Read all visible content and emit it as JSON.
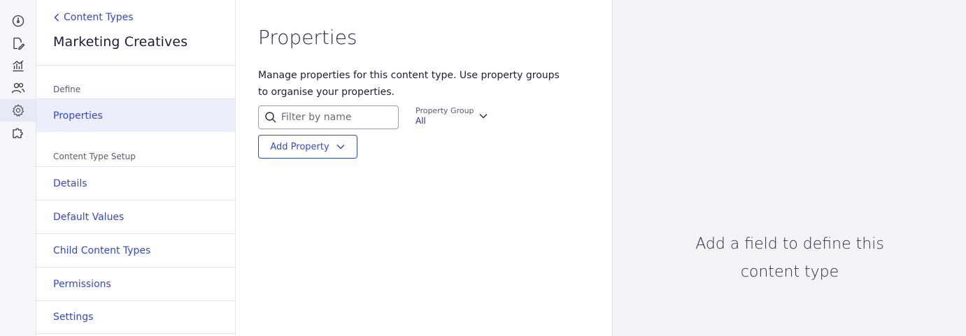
{
  "rail": {
    "items": [
      {
        "icon": "dashboard-icon"
      },
      {
        "icon": "edit-document-icon"
      },
      {
        "icon": "analytics-icon"
      },
      {
        "icon": "users-icon"
      },
      {
        "icon": "gear-icon",
        "active": true
      },
      {
        "icon": "puzzle-icon"
      }
    ]
  },
  "sidebar": {
    "back_label": "Content Types",
    "title": "Marketing Creatives",
    "define_label": "Define",
    "properties_label": "Properties",
    "setup_label": "Content Type Setup",
    "items": [
      {
        "label": "Details"
      },
      {
        "label": "Default Values"
      },
      {
        "label": "Child Content Types"
      },
      {
        "label": "Permissions"
      },
      {
        "label": "Settings"
      }
    ]
  },
  "main": {
    "title": "Properties",
    "description": "Manage properties for this content type. Use property groups to organise your properties.",
    "filter_placeholder": "Filter by name",
    "group_label": "Property Group",
    "group_value": "All",
    "add_label": "Add Property"
  },
  "detail": {
    "empty_message": "Add a field to define this content type"
  },
  "colors": {
    "accent": "#3147d8",
    "active_bg": "#eceefb",
    "panel_bg": "#f4f4f6"
  }
}
